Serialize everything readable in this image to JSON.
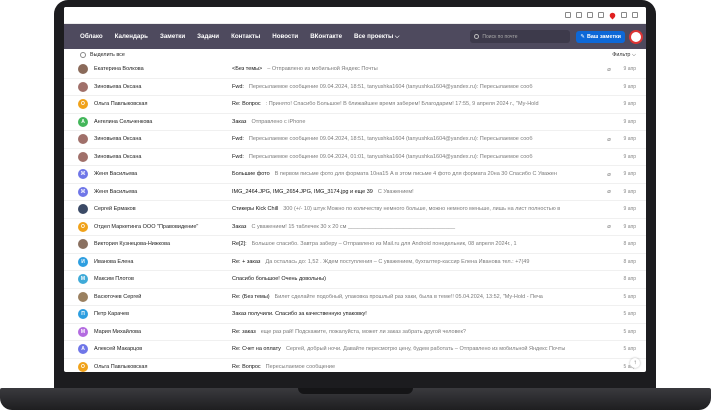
{
  "nav": {
    "items": [
      "Облако",
      "Календарь",
      "Заметки",
      "Задачи",
      "Контакты",
      "Новости",
      "ВКонтакте",
      "Все проекты"
    ],
    "search_placeholder": "Поиск по почте",
    "write_label": "Ваш заметки"
  },
  "list": {
    "select_all": "Выделить все",
    "filter": "Фильтр"
  },
  "colors": {
    "header": "#4e4a5e",
    "accent": "#0d68d8"
  },
  "emails": [
    {
      "sender": "Екатерина Волкова",
      "subject": "<Без темы>",
      "snippet": "– Отправлено из мобильной Яндекс Почты",
      "date": "9 апр",
      "clip": true,
      "avatar": "photo",
      "color": "#8a6a5a",
      "letter": ""
    },
    {
      "sender": "Зиновьева Оксана",
      "subject": "Fwd:",
      "snippet": "Пересылаемое сообщение 09.04.2024, 18:51, tanyushka1604 (tanyushka1604@yandex.ru): Пересылаемое сооб",
      "date": "9 апр",
      "clip": false,
      "avatar": "photo",
      "color": "#a0706a",
      "letter": ""
    },
    {
      "sender": "Ольга Павлыковская",
      "subject": "Re: Вопрос",
      "snippet": ": Принято! Спасибо Большое! В ближайшее время заберем! Благодарим! 17:55, 9 апреля 2024 г., \"My-Hold",
      "date": "9 апр",
      "clip": false,
      "avatar": "letter",
      "color": "#f0a21a",
      "letter": "О"
    },
    {
      "sender": "Ангелина Сельченкова",
      "subject": "Заказ",
      "snippet": "Отправлено с iPhone",
      "date": "9 апр",
      "clip": false,
      "avatar": "letter",
      "color": "#43b65a",
      "letter": "А"
    },
    {
      "sender": "Зиновьева Оксана",
      "subject": "Fwd:",
      "snippet": "Пересылаемое сообщение 09.04.2024, 18:51, tanyushka1604 (tanyushka1604@yandex.ru): Пересылаемое сооб",
      "date": "9 апр",
      "clip": true,
      "avatar": "photo",
      "color": "#a0706a",
      "letter": ""
    },
    {
      "sender": "Зиновьева Оксана",
      "subject": "Fwd:",
      "snippet": "Пересылаемое сообщение 09.04.2024, 01:01, tanyushka1604 (tanyushka1604@yandex.ru): Пересылаемое сооб",
      "date": "9 апр",
      "clip": false,
      "avatar": "photo",
      "color": "#a0706a",
      "letter": ""
    },
    {
      "sender": "Женя Васильева",
      "subject": "Большие фото",
      "snippet": "В первом письме фото для формата 10на15 А в этом письме 4 фото для формата 20на 30 Спасибо С Уважен",
      "date": "9 апр",
      "clip": true,
      "avatar": "letter",
      "color": "#6f76e8",
      "letter": "Ж"
    },
    {
      "sender": "Женя Васильева",
      "subject": "IMG_2464.JPG, IMG_2654.JPG, IMG_3174.jpg и еще 39",
      "snippet": "С Уважением!",
      "date": "9 апр",
      "clip": true,
      "avatar": "letter",
      "color": "#6f76e8",
      "letter": "Ж"
    },
    {
      "sender": "Сергей Ермаков",
      "subject": "Стикеры Kick Chill",
      "snippet": "300 (+/- 10) штук Можно по количеству немного больше, можно немного меньше, лишь на лист полностью в",
      "date": "9 апр",
      "clip": false,
      "avatar": "photo",
      "color": "#3b4a66",
      "letter": ""
    },
    {
      "sender": "Отдел Маркетинга ООО \"Правовидение\"",
      "subject": "Заказ",
      "snippet": "С уважением! 15 таблечек 30 х 20 см ___________________________________",
      "date": "9 апр",
      "clip": true,
      "avatar": "letter",
      "color": "#f0a21a",
      "letter": "О"
    },
    {
      "sender": "Виктория Кузнецова-Нижкова",
      "subject": "Re[2]:",
      "snippet": "Большое спасибо. Завтра заберу – Отправлено из Mail.ru для Android понедельник, 08 апреля 2024г., 1",
      "date": "8 апр",
      "clip": false,
      "avatar": "photo",
      "color": "#8a7060",
      "letter": ""
    },
    {
      "sender": "Иванова Елена",
      "subject": "Re: + заказ",
      "snippet": "Да осталась до: 1,52 . Ждем поступления – С уважением, бухгалтер-кассир Елена Иванова тел.: +7(49",
      "date": "8 апр",
      "clip": false,
      "avatar": "letter",
      "color": "#2d9ee0",
      "letter": "И"
    },
    {
      "sender": "Максим Плотов",
      "subject": "Спасибо большое! Очень довольны)",
      "snippet": "",
      "date": "8 апр",
      "clip": false,
      "avatar": "letter",
      "color": "#3faad8",
      "letter": "М"
    },
    {
      "sender": "Васюточев Сергей",
      "subject": "Re: (Без темы)",
      "snippet": "Билет сделайте подобный, упаковка прошлый раз хаки, была в теме!! 05.04.2024, 13:52, \"My-Hold - Печа",
      "date": "5 апр",
      "clip": false,
      "avatar": "photo",
      "color": "#9a8060",
      "letter": ""
    },
    {
      "sender": "Петр Карачев",
      "subject": "Заказ получили. Спасибо за качественную упаковку!",
      "snippet": "",
      "date": "5 апр",
      "clip": false,
      "avatar": "letter",
      "color": "#2d9ee0",
      "letter": "П"
    },
    {
      "sender": "Мария Михайлова",
      "subject": "Re: заказ",
      "snippet": "еще раз рай! Подскажите, пожалуйста, может ли заказ забрать другой человек?",
      "date": "5 апр",
      "clip": false,
      "avatar": "letter",
      "color": "#b36be0",
      "letter": "М"
    },
    {
      "sender": "Алексей Макарцов",
      "subject": "Re: Счет на оплату",
      "snippet": "Сергей, добрый ночи. Давайте пересмотрю цену, будем работать – Отправлено из мобильной Яндекс Почты",
      "date": "5 апр",
      "clip": false,
      "avatar": "letter",
      "color": "#6f76e8",
      "letter": "А"
    },
    {
      "sender": "Ольга Павлыковская",
      "subject": "Re: Вопрос",
      "snippet": "Пересылаемое сообщение",
      "date": "5 апр",
      "clip": false,
      "avatar": "letter",
      "color": "#f0a21a",
      "letter": "О"
    }
  ]
}
